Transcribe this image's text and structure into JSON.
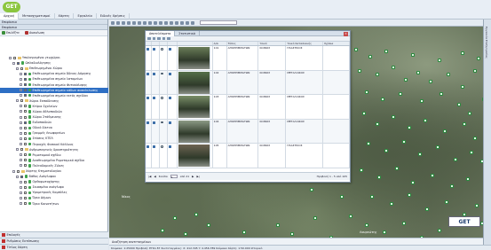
{
  "app": {
    "logo": "GET"
  },
  "menu": [
    {
      "label": "Αρχική",
      "active": true
    },
    {
      "label": "Μετασχηματισμοί",
      "active": false
    },
    {
      "label": "Χάρτες",
      "active": false
    },
    {
      "label": "Εργαλεία",
      "active": false
    },
    {
      "label": "Ειδικές Χρήσεις",
      "active": false
    }
  ],
  "left_panel": {
    "header": "Επιφάνεια",
    "sub_header": "Επιφάνεια",
    "tabs": [
      "Επιλέξτε",
      "Ανανέωση"
    ],
    "tree": [
      {
        "indent": 10,
        "label": "Υπολογισμένοι γεωχώροι",
        "type": "folder",
        "checked": false
      },
      {
        "indent": 14,
        "label": "Ωπλαδιολόγησης",
        "type": "layer",
        "checked": true
      },
      {
        "indent": 18,
        "label": "Επιθεωρημένοι Χώροι",
        "type": "folder",
        "checked": false
      },
      {
        "indent": 22,
        "label": "Επιθεωρημένα σημεία Άδειας Δόμησης",
        "type": "layer",
        "checked": true
      },
      {
        "indent": 22,
        "label": "Επιθεωρημένα σημεία λατομείων",
        "type": "layer",
        "checked": true
      },
      {
        "indent": 22,
        "label": "Επιθεωρημένα σημεία Φυτοκάλυψης",
        "type": "layer",
        "checked": true
      },
      {
        "indent": 22,
        "label": "Επιθεωρημένα σημεία κάδων ανακύκλωσης",
        "type": "layer",
        "checked": true,
        "selected": true
      },
      {
        "indent": 22,
        "label": "Επιθεωρημένα σημεία εκτός σχεδίου",
        "type": "layer",
        "checked": true
      },
      {
        "indent": 18,
        "label": "Χώροι Εκπαίδευσης",
        "type": "folder",
        "checked": false
      },
      {
        "indent": 22,
        "label": "Κτίρια Σχολείων",
        "type": "layer",
        "checked": false
      },
      {
        "indent": 22,
        "label": "Χώροι Αθλοπαιδιών",
        "type": "layer",
        "checked": false
      },
      {
        "indent": 22,
        "label": "Χώροι Στάθμευσης",
        "type": "layer",
        "checked": false
      },
      {
        "indent": 22,
        "label": "Ενδοπαιδιών",
        "type": "layer",
        "checked": true
      },
      {
        "indent": 22,
        "label": "Οδικό δίκτυο",
        "type": "layer",
        "checked": false
      },
      {
        "indent": 22,
        "label": "Γραμμές Λεωφορείων",
        "type": "layer",
        "checked": false
      },
      {
        "indent": 22,
        "label": "Στάσεις ΚΤΕΛ",
        "type": "layer",
        "checked": false
      },
      {
        "indent": 22,
        "label": "Περιοχές Φυσικού Κάλλους",
        "type": "layer",
        "checked": false
      },
      {
        "indent": 18,
        "label": "Ανθρωπογενείς δραστηριότητες",
        "type": "folder",
        "checked": false
      },
      {
        "indent": 22,
        "label": "Ρυμοτομικό σχέδιο",
        "type": "layer",
        "checked": false
      },
      {
        "indent": 22,
        "label": "Αναθεωρημένο Ρυμοτομικό σχέδιο",
        "type": "layer",
        "checked": false
      },
      {
        "indent": 22,
        "label": "Πολεοδομικές Ζώνες",
        "type": "layer",
        "checked": false
      },
      {
        "indent": 14,
        "label": "Χάρτης Κτηματολογίου",
        "type": "folder",
        "checked": false
      },
      {
        "indent": 18,
        "label": "Βάθος Ανάγλυφου",
        "type": "layer",
        "checked": true
      },
      {
        "indent": 22,
        "label": "Ορθοφωτοχάρτης",
        "type": "layer",
        "checked": false
      },
      {
        "indent": 22,
        "label": "Σκιασμένο ανάγλυφο",
        "type": "layer",
        "checked": false
      },
      {
        "indent": 22,
        "label": "Υψομετρικές Καμπύλες",
        "type": "layer",
        "checked": false
      },
      {
        "indent": 22,
        "label": "Όρια Δήμων",
        "type": "layer",
        "checked": false
      },
      {
        "indent": 22,
        "label": "Όρια Κοινοτήτων",
        "type": "layer",
        "checked": false
      }
    ],
    "bottom": [
      "Επιλογές",
      "Ρυθμίσεις Εκτύπωσης",
      "Τίτλος Χάρτη"
    ]
  },
  "grid": {
    "tabs": [
      "Αποτελέσματα",
      "Στατιστικά"
    ],
    "columns": [
      "",
      "",
      "",
      "",
      "",
      "Α/Α",
      "Τύπος",
      "Υλικό",
      "Υλικό Κατασκευής",
      "Σχόλια"
    ],
    "rows": [
      {
        "aa": "101",
        "type": "ΑΠΟΡΡΙΜΜΑΤΩΝ",
        "mat": "ΚΟΙΝΟΣ",
        "build": "ΠΛΑΣΤΙΚΟΣ",
        "img": "#6a7d58"
      },
      {
        "aa": "102",
        "type": "ΑΠΟΡΡΙΜΜΑΤΩΝ",
        "mat": "ΚΟΙΝΟΣ",
        "build": "ΜΕΤΑΛΛΙΚΟΣ",
        "img": "#55704a"
      },
      {
        "aa": "103",
        "type": "ΑΠΟΡΡΙΜΜΑΤΩΝ",
        "mat": "ΚΟΙΝΟΣ",
        "build": "ΜΕΤΑΛΛΙΚΟΣ",
        "img": "#7a8e68"
      },
      {
        "aa": "104",
        "type": "ΑΠΟΡΡΙΜΜΑΤΩΝ",
        "mat": "ΚΟΙΝΟΣ",
        "build": "ΜΕΤΑΛΛΙΚΟΣ",
        "img": "#8c9a85"
      },
      {
        "aa": "105",
        "type": "ΑΠΟΡΡΙΜΜΑΤΩΝ",
        "mat": "ΚΟΙΝΟΣ",
        "build": "ΠΛΑΣΤΙΚΟΣ",
        "img": "#6e6352"
      }
    ],
    "pager": {
      "page_label": "Σελίδα",
      "page": "1",
      "of_label": "από 21",
      "display": "Προβολή 1 - 5 από 105"
    }
  },
  "map": {
    "watermark": "GET",
    "labels": [
      {
        "text": "Νίκος"
      },
      {
        "text": "Λαυρεώτης"
      }
    ],
    "bottom_label": "Αναζήτηση συντεταγμένων"
  },
  "status": {
    "text": "Κλίμακα: 1:25000    Προβολή: ΕΓΣΑ 87    Συντεταγμένες: X: 412.345  Y: 4.456.789    Κλίμακα Χάρτη: 1:50.000    Ιστορικό"
  },
  "right_strip": {
    "label": "Εργαλεία Επεξεργασίας"
  },
  "colors": {
    "accent": "#2e6fc4",
    "marker": "#2b8a3e",
    "logo": "#8cc63f"
  }
}
